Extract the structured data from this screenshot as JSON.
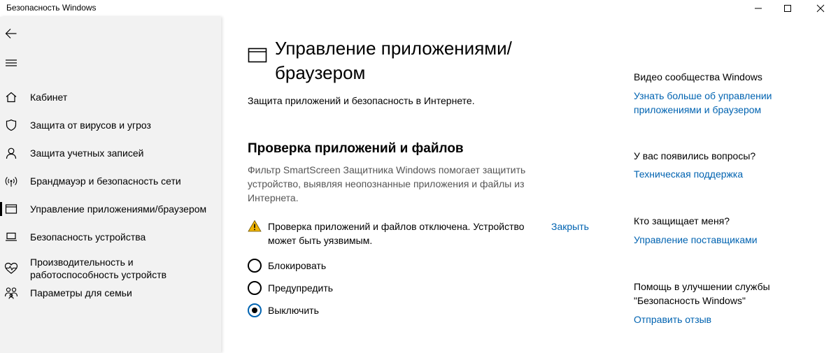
{
  "window": {
    "title": "Безопасность Windows"
  },
  "sidebar": {
    "items": [
      {
        "label": "Кабинет",
        "icon": "home-icon"
      },
      {
        "label": "Защита от вирусов и угроз",
        "icon": "shield-icon"
      },
      {
        "label": "Защита учетных записей",
        "icon": "person-icon"
      },
      {
        "label": "Брандмауэр и безопасность сети",
        "icon": "wifi-icon"
      },
      {
        "label": "Управление приложениями/браузером",
        "icon": "app-window-icon",
        "active": true
      },
      {
        "label": "Безопасность устройства",
        "icon": "laptop-icon"
      },
      {
        "label": "Производительность и работоспособность устройств",
        "icon": "heart-icon"
      },
      {
        "label": "Параметры для семьи",
        "icon": "family-icon"
      }
    ]
  },
  "main": {
    "title": "Управление приложениями/ браузером",
    "subtitle": "Защита приложений и безопасность в Интернете.",
    "section": {
      "title": "Проверка приложений и файлов",
      "description": "Фильтр SmartScreen Защитника Windows помогает защитить устройство, выявляя неопознанные приложения и файлы из Интернета.",
      "warning_text": "Проверка приложений и файлов отключена. Устройство может быть уязвимым.",
      "warning_link": "Закрыть",
      "options": [
        {
          "label": "Блокировать",
          "checked": false
        },
        {
          "label": "Предупредить",
          "checked": false
        },
        {
          "label": "Выключить",
          "checked": true
        }
      ]
    }
  },
  "right": {
    "community_heading": "Видео сообщества Windows",
    "community_link": "Узнать больше об управлении приложениями и браузером",
    "questions_heading": "У вас появились вопросы?",
    "questions_link": "Техническая поддержка",
    "protect_heading": "Кто защищает меня?",
    "protect_link": "Управление поставщиками",
    "improve_heading": "Помощь в улучшении службы \"Безопасность Windows\"",
    "improve_link": "Отправить отзыв"
  },
  "colors": {
    "accent": "#0063b1",
    "sidebar_bg": "#f2f2f2",
    "warning": "#f0b400"
  }
}
